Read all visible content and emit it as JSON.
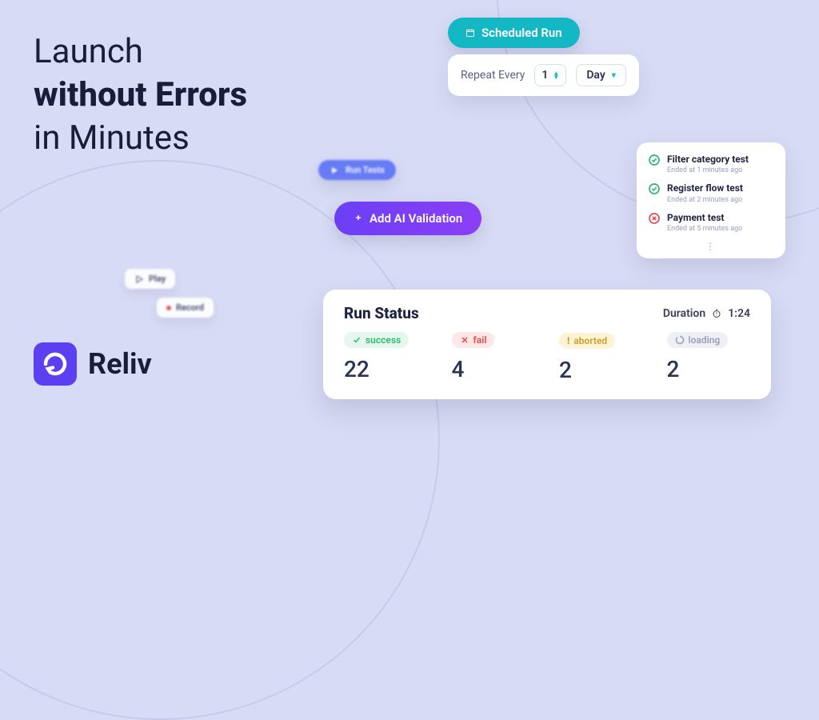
{
  "headline": {
    "line1": "Launch",
    "line2": "without Errors",
    "line3": "in Minutes"
  },
  "brand": {
    "name": "Reliv"
  },
  "scheduled": {
    "label": "Scheduled Run"
  },
  "repeat": {
    "label": "Repeat Every",
    "value": "1",
    "unit": "Day"
  },
  "run_tests": {
    "label": "Run Tests"
  },
  "ai_validation": {
    "label": "Add AI Validation"
  },
  "tests": [
    {
      "title": "Filter category test",
      "sub": "Ended at 1 minutes ago",
      "status": "ok"
    },
    {
      "title": "Register flow test",
      "sub": "Ended at 2 minutes ago",
      "status": "ok"
    },
    {
      "title": "Payment test",
      "sub": "Ended at 5 minutes ago",
      "status": "err"
    }
  ],
  "chips": {
    "play": "Play",
    "record": "Record"
  },
  "status": {
    "title": "Run Status",
    "duration_label": "Duration",
    "duration_value": "1:24",
    "cols": {
      "success": {
        "label": "success",
        "count": "22"
      },
      "fail": {
        "label": "fail",
        "count": "4"
      },
      "aborted": {
        "label": "aborted",
        "count": "2"
      },
      "loading": {
        "label": "loading",
        "count": "2"
      }
    }
  }
}
